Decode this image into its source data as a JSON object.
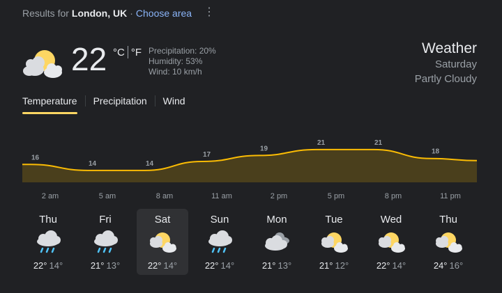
{
  "header": {
    "results_prefix": "Results for",
    "location": "London, UK",
    "separator": "·",
    "choose_area": "Choose area",
    "menu_glyph": "⋮"
  },
  "current": {
    "icon": "partly-cloudy-icon",
    "temperature": "22",
    "unit_c": "°C",
    "unit_f": "°F",
    "precipitation": "Precipitation: 20%",
    "humidity": "Humidity: 53%",
    "wind": "Wind: 10 km/h"
  },
  "title": {
    "heading": "Weather",
    "day": "Saturday",
    "condition": "Partly Cloudy"
  },
  "tabs": [
    {
      "label": "Temperature",
      "active": true
    },
    {
      "label": "Precipitation",
      "active": false
    },
    {
      "label": "Wind",
      "active": false
    }
  ],
  "chart_data": {
    "type": "area",
    "x": [
      "2 am",
      "5 am",
      "8 am",
      "11 am",
      "2 pm",
      "5 pm",
      "8 pm",
      "11 pm"
    ],
    "values": [
      16,
      14,
      14,
      17,
      19,
      21,
      21,
      18
    ],
    "series_color": "#fbbc04",
    "fill_color": "#4a3f1c"
  },
  "days": [
    {
      "name": "Thu",
      "icon": "rain-icon",
      "high": "22°",
      "low": "14°",
      "selected": false
    },
    {
      "name": "Fri",
      "icon": "rain-icon",
      "high": "21°",
      "low": "13°",
      "selected": false
    },
    {
      "name": "Sat",
      "icon": "partly-cloudy-icon",
      "high": "22°",
      "low": "14°",
      "selected": true
    },
    {
      "name": "Sun",
      "icon": "rain-icon",
      "high": "22°",
      "low": "14°",
      "selected": false
    },
    {
      "name": "Mon",
      "icon": "cloudy-icon",
      "high": "21°",
      "low": "13°",
      "selected": false
    },
    {
      "name": "Tue",
      "icon": "partly-cloudy-icon",
      "high": "21°",
      "low": "12°",
      "selected": false
    },
    {
      "name": "Wed",
      "icon": "partly-cloudy-icon",
      "high": "22°",
      "low": "14°",
      "selected": false
    },
    {
      "name": "Thu",
      "icon": "partly-cloudy-icon",
      "high": "24°",
      "low": "16°",
      "selected": false
    }
  ],
  "colors": {
    "background": "#202124",
    "accent_tab": "#fdd663",
    "link": "#8ab4f8",
    "sun": "#fdd663",
    "rain": "#4fc3f7"
  }
}
